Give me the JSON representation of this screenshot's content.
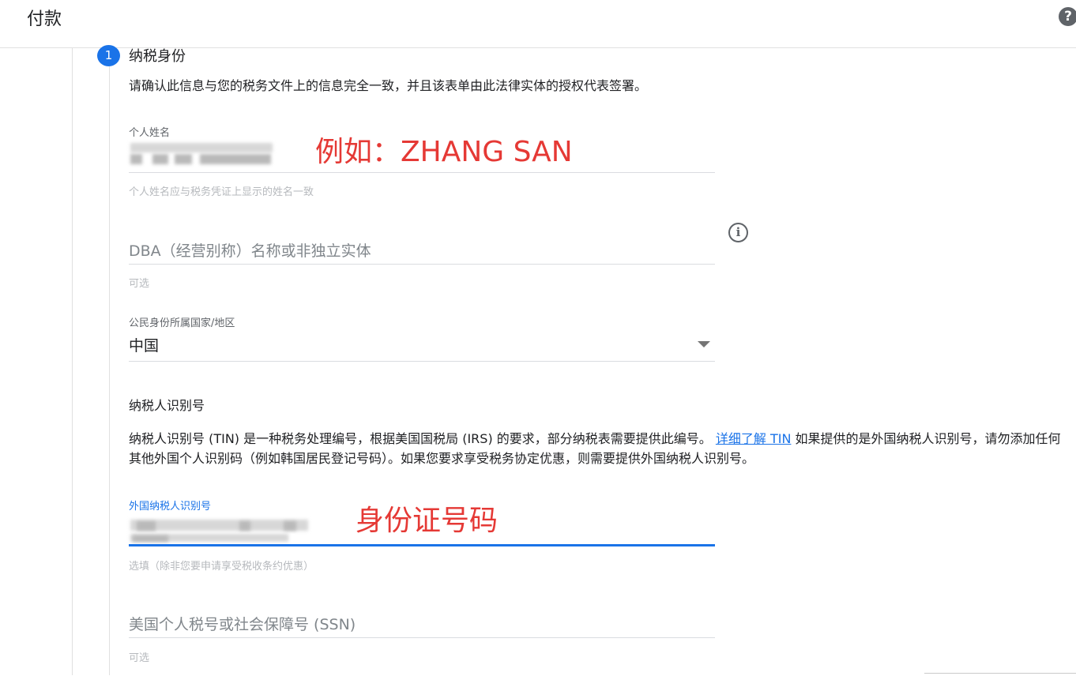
{
  "header": {
    "title": "付款",
    "help_icon": "help-icon",
    "help_glyph": "?"
  },
  "step": {
    "number": "1",
    "title": "纳税身份",
    "intro": "请确认此信息与您的税务文件上的信息完全一致，并且该表单由此法律实体的授权代表签署。"
  },
  "fields": {
    "individual_name": {
      "label": "个人姓名",
      "value": "",
      "helper": "个人姓名应与税务凭证上显示的姓名一致"
    },
    "dba": {
      "placeholder": "DBA（经营别称）名称或非独立实体",
      "helper": "可选",
      "info_icon": "info-icon",
      "info_glyph": "i"
    },
    "citizenship": {
      "label": "公民身份所属国家/地区",
      "value": "中国",
      "icon": "dropdown-arrow-icon"
    },
    "foreign_tin": {
      "label": "外国纳税人识别号",
      "value": "",
      "helper": "选填（除非您要申请享受税收条约优惠）"
    },
    "ssn": {
      "placeholder": "美国个人税号或社会保障号 (SSN)",
      "helper": "可选"
    }
  },
  "tin_section": {
    "heading": "纳税人识别号",
    "description_before": "纳税人识别号 (TIN) 是一种税务处理编号，根据美国国税局 (IRS) 的要求，部分纳税表需要提供此编号。",
    "link_text": "详细了解 TIN",
    "description_after": "如果提供的是外国纳税人识别号，请勿添加任何其他外国个人识别码（例如韩国居民登记号码）。如果您要求享受税务协定优惠，则需要提供外国纳税人识别号。"
  },
  "annotations": {
    "name_example": "例如：ZHANG SAN",
    "id_number": "身份证号码",
    "color": "#e53935"
  },
  "colors": {
    "accent": "#1a73e8",
    "annotation": "#e53935"
  }
}
